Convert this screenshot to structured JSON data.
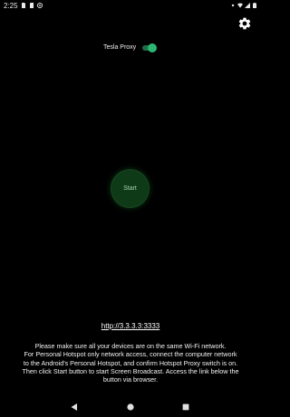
{
  "status_bar": {
    "time": "2:25",
    "left_icons": [
      "sim-icon",
      "sd-card-icon",
      "sync-icon"
    ],
    "right_icons": [
      "dot-icon",
      "wifi-icon",
      "signal-icon",
      "battery-icon"
    ]
  },
  "toolbar": {
    "settings_icon": "gear-icon"
  },
  "proxy": {
    "label": "Tesla Proxy",
    "enabled": true
  },
  "start_button": {
    "label": "Start"
  },
  "url": {
    "text": "http://3.3.3.3:3333"
  },
  "instructions": {
    "lines": [
      "Please make sure all your devices are on the same Wi-Fi network.",
      "For Personal Hotspot only network access, connect the computer network",
      "to the Android's Personal Hotspot, and confirm Hotspot Proxy switch is on.",
      "Then click Start button to start Screen Broadcast. Access the link below the",
      "button via browser."
    ]
  },
  "nav_bar": {
    "buttons": [
      "back-icon",
      "home-icon",
      "recents-icon"
    ]
  },
  "colors": {
    "accent": "#2bb673",
    "start_bg": "#0f3a18",
    "background": "#000000"
  }
}
